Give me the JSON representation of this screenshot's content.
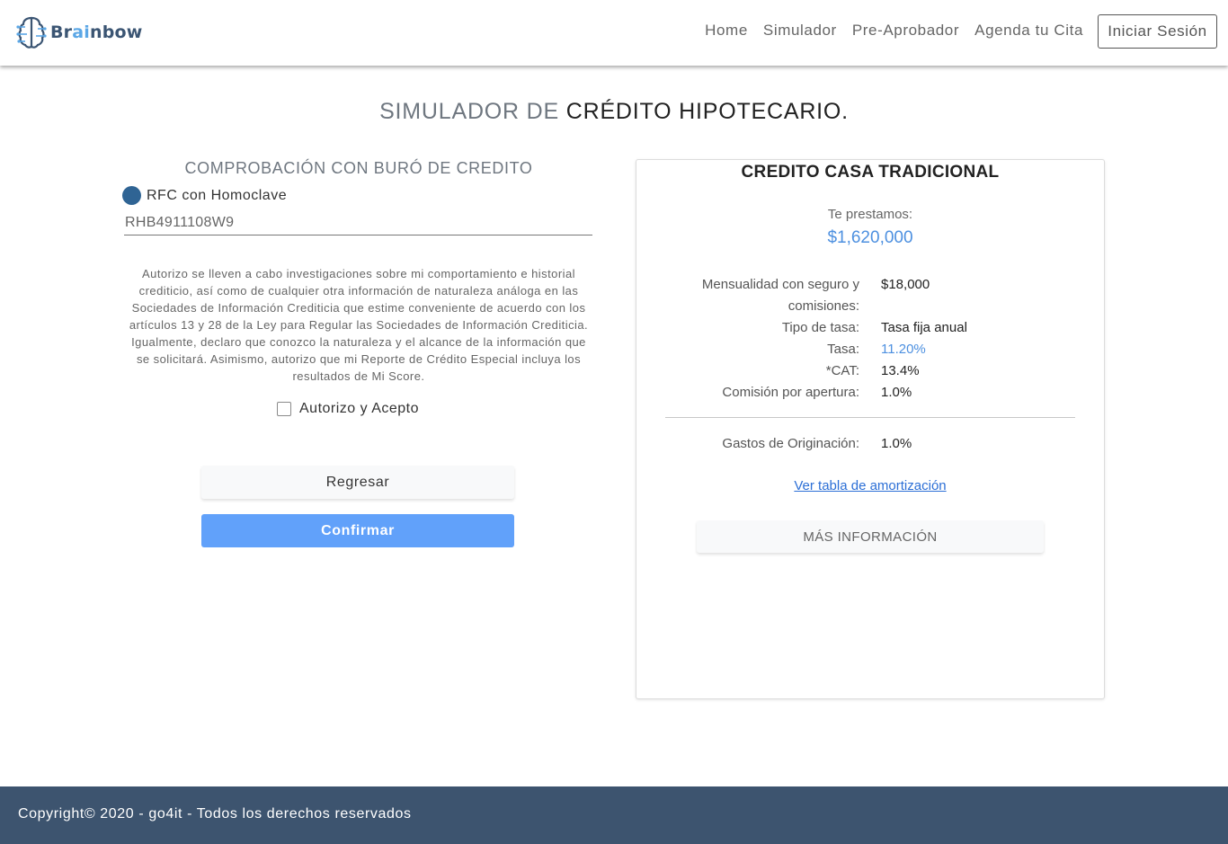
{
  "header": {
    "logo": {
      "prefix": "Br",
      "accent": "ai",
      "suffix": "nbow",
      "brand_color": "#3b5573",
      "accent_color": "#5ba7e6",
      "icon": "brain-circuit-icon"
    },
    "nav": [
      {
        "label": "Home"
      },
      {
        "label": "Simulador"
      },
      {
        "label": "Pre-Aprobador"
      },
      {
        "label": "Agenda tu Cita"
      }
    ],
    "login_label": "Iniciar Sesión"
  },
  "page_title": {
    "part1": "SIMULADOR DE ",
    "part2": "CRÉDITO HIPOTECARIO."
  },
  "buro": {
    "title": "COMPROBACIÓN CON BURÓ DE CREDITO",
    "rfc_label": "RFC con Homoclave",
    "rfc_value": "RHB4911108W9",
    "legal_lines": [
      "Autorizo se lleven a cabo investigaciones sobre mi comportamiento e historial",
      "crediticio, así como de cualquier otra información de naturaleza análoga en las",
      "Sociedades de Información Crediticia que estime conveniente de acuerdo con los",
      "artículos 13 y 28 de la Ley para Regular las Sociedades de Información Crediticia.",
      "Igualmente, declaro que conozco la naturaleza y el alcance de la información que",
      "se solicitará. Asimismo, autorizo que mi Reporte de Crédito Especial incluya los",
      "resultados de Mi Score."
    ],
    "accept_label": "Autorizo y Acepto",
    "accept_checked": false,
    "back_label": "Regresar",
    "confirm_label": "Confirmar",
    "confirm_color": "#61a1fa"
  },
  "card": {
    "title": "CREDITO CASA TRADICIONAL",
    "loan_label": "Te prestamos:",
    "loan_amount": "$1,620,000",
    "details": [
      {
        "label_line1": "Mensualidad con seguro y",
        "label_line2": "comisiones:",
        "value": "$18,000"
      },
      {
        "label": "Tipo de tasa:",
        "value": "Tasa fija anual"
      },
      {
        "label": "Tasa:",
        "value": "11.20%"
      },
      {
        "label": "*CAT:",
        "value": "13.4%"
      },
      {
        "label": "Comisión por apertura:",
        "value": "1.0%"
      },
      {
        "label": "Gastos de Originación:",
        "value": "1.0%"
      }
    ],
    "amortization_link": "Ver tabla de amortización",
    "more_info_label": "MÁS INFORMACIÓN"
  },
  "footer": {
    "text": "Copyright© 2020 - go4it - Todos los derechos reservados",
    "color": "#3d546f"
  }
}
